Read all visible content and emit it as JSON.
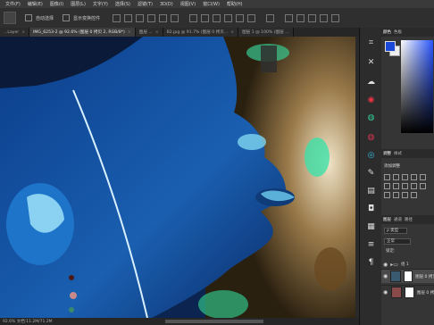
{
  "menubar": {
    "items": [
      "文件(F)",
      "编辑(E)",
      "图像(I)",
      "图层(L)",
      "文字(Y)",
      "选择(S)",
      "滤镜(T)",
      "3D(D)",
      "视图(V)",
      "窗口(W)",
      "帮助(H)"
    ]
  },
  "options": {
    "auto_select_label": "自动选择",
    "show_transform_label": "显示变换控件"
  },
  "tabs": [
    {
      "label": "...Layer",
      "active": false
    },
    {
      "label": "IMG_6253-2 @ 92.6% (图层 0 拷贝 2, RGB/8*)",
      "active": true
    },
    {
      "label": "图层 ...",
      "active": false
    },
    {
      "label": "B2.jpg @ 91.7% (图层 0 拷贝...",
      "active": false
    },
    {
      "label": "图层 1 @ 100% (图层 ...",
      "active": false
    }
  ],
  "status": {
    "text": "92.6%  文档:11.2M/71.2M"
  },
  "toolbar_icons": [
    "transform-icon",
    "close-x-icon",
    "blob-icon",
    "palette-icon",
    "stamp-a-icon",
    "stamp-b-icon",
    "target-icon",
    "brush-icon",
    "document-icon",
    "camera-icon",
    "grid-icon",
    "slider-icon",
    "text-icon"
  ],
  "panel": {
    "top_tabs": [
      {
        "label": "颜色",
        "active": true
      },
      {
        "label": "色板",
        "active": false
      }
    ],
    "colors": {
      "foreground": "#1a48d8",
      "background": "#eeeeee"
    },
    "adjust_tabs": [
      {
        "label": "调整",
        "active": true
      },
      {
        "label": "样式",
        "active": false
      }
    ],
    "adjust_title": "添加调整",
    "layers_tabs": [
      {
        "label": "图层",
        "active": true
      },
      {
        "label": "通道",
        "active": false
      },
      {
        "label": "路径",
        "active": false
      }
    ],
    "filter_kind": "ρ 类型",
    "blend_mode": "正常",
    "lock_label": "锁定:",
    "group_name": "组 1",
    "layers": [
      {
        "name": "图层 0 拷贝 2",
        "selected": true
      },
      {
        "name": "图层 0 拷贝",
        "selected": false
      }
    ]
  }
}
